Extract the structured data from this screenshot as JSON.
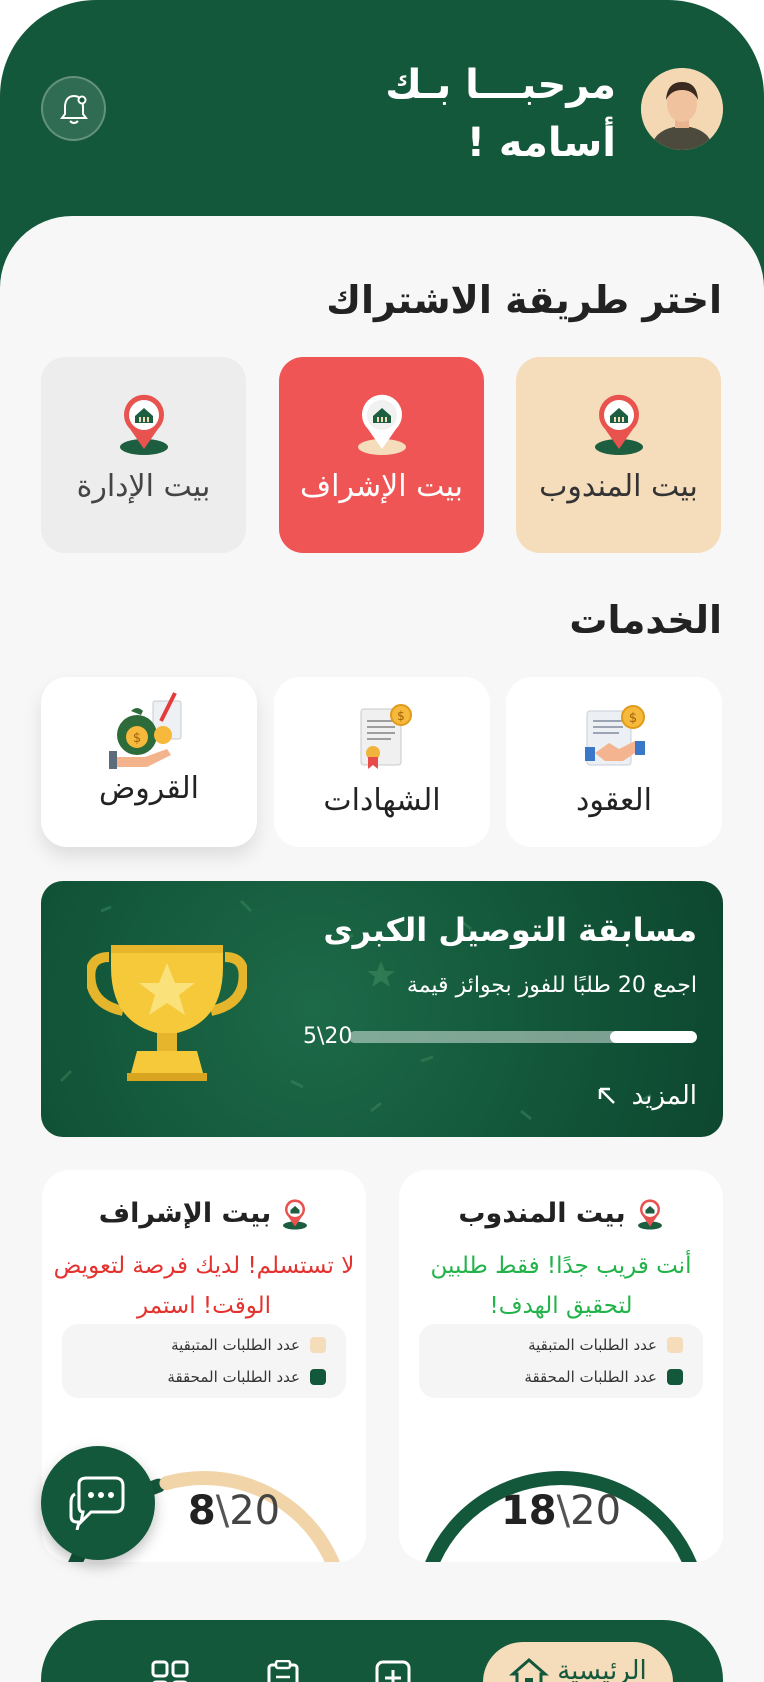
{
  "header": {
    "greeting_line1": "مرحبـــا بـك",
    "greeting_line2": "أسامه !"
  },
  "subscription": {
    "title": "اختر طريقة الاشتراك",
    "options": [
      {
        "label": "بيت المندوب"
      },
      {
        "label": "بيت الإشراف"
      },
      {
        "label": "بيت الإدارة"
      }
    ]
  },
  "services": {
    "title": "الخدمات",
    "items": [
      {
        "label": "العقود",
        "icon": "contract-icon"
      },
      {
        "label": "الشهادات",
        "icon": "certificate-icon"
      },
      {
        "label": "القروض",
        "icon": "loan-icon"
      }
    ]
  },
  "competition": {
    "title": "مسابقة التوصيل الكبرى",
    "subtitle": "اجمع 20 طلبًا للفوز بجوائز قيمة",
    "progress_text": "5\\20",
    "progress_fraction": 0.25,
    "more_label": "المزيد"
  },
  "stats": [
    {
      "title": "بيت المندوب",
      "message": "أنت قريب جدًا! فقط طلبين لتحقيق الهدف!",
      "legend_remaining": "عدد الطلبات المتبقية",
      "legend_achieved": "عدد الطلبات المحققة",
      "achieved": "18",
      "total": "20",
      "separator": "\\"
    },
    {
      "title": "بيت الإشراف",
      "message": "لا تستسلم! لديك فرصة لتعويض الوقت! استمر",
      "legend_remaining": "عدد الطلبات المتبقية",
      "legend_achieved": "عدد الطلبات المحققة",
      "achieved": "8",
      "total": "20",
      "separator": "\\"
    }
  ],
  "nav": {
    "home_label": "الرئيسية"
  },
  "colors": {
    "primary": "#14583c",
    "accent_red": "#f05556",
    "beige": "#f5dcbb",
    "background": "#f7f7f7"
  }
}
